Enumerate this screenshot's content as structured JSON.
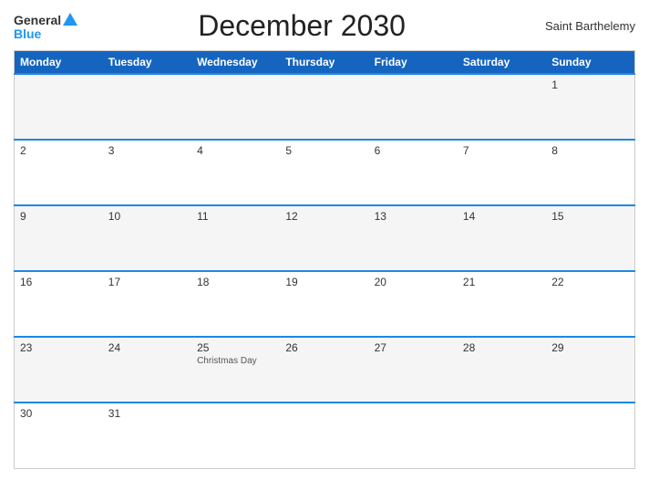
{
  "header": {
    "logo_general": "General",
    "logo_blue": "Blue",
    "title": "December 2030",
    "region": "Saint Barthelemy"
  },
  "weekdays": [
    "Monday",
    "Tuesday",
    "Wednesday",
    "Thursday",
    "Friday",
    "Saturday",
    "Sunday"
  ],
  "weeks": [
    [
      {
        "num": "",
        "holiday": ""
      },
      {
        "num": "",
        "holiday": ""
      },
      {
        "num": "",
        "holiday": ""
      },
      {
        "num": "",
        "holiday": ""
      },
      {
        "num": "",
        "holiday": ""
      },
      {
        "num": "",
        "holiday": ""
      },
      {
        "num": "1",
        "holiday": ""
      }
    ],
    [
      {
        "num": "2",
        "holiday": ""
      },
      {
        "num": "3",
        "holiday": ""
      },
      {
        "num": "4",
        "holiday": ""
      },
      {
        "num": "5",
        "holiday": ""
      },
      {
        "num": "6",
        "holiday": ""
      },
      {
        "num": "7",
        "holiday": ""
      },
      {
        "num": "8",
        "holiday": ""
      }
    ],
    [
      {
        "num": "9",
        "holiday": ""
      },
      {
        "num": "10",
        "holiday": ""
      },
      {
        "num": "11",
        "holiday": ""
      },
      {
        "num": "12",
        "holiday": ""
      },
      {
        "num": "13",
        "holiday": ""
      },
      {
        "num": "14",
        "holiday": ""
      },
      {
        "num": "15",
        "holiday": ""
      }
    ],
    [
      {
        "num": "16",
        "holiday": ""
      },
      {
        "num": "17",
        "holiday": ""
      },
      {
        "num": "18",
        "holiday": ""
      },
      {
        "num": "19",
        "holiday": ""
      },
      {
        "num": "20",
        "holiday": ""
      },
      {
        "num": "21",
        "holiday": ""
      },
      {
        "num": "22",
        "holiday": ""
      }
    ],
    [
      {
        "num": "23",
        "holiday": ""
      },
      {
        "num": "24",
        "holiday": ""
      },
      {
        "num": "25",
        "holiday": "Christmas Day"
      },
      {
        "num": "26",
        "holiday": ""
      },
      {
        "num": "27",
        "holiday": ""
      },
      {
        "num": "28",
        "holiday": ""
      },
      {
        "num": "29",
        "holiday": ""
      }
    ],
    [
      {
        "num": "30",
        "holiday": ""
      },
      {
        "num": "31",
        "holiday": ""
      },
      {
        "num": "",
        "holiday": ""
      },
      {
        "num": "",
        "holiday": ""
      },
      {
        "num": "",
        "holiday": ""
      },
      {
        "num": "",
        "holiday": ""
      },
      {
        "num": "",
        "holiday": ""
      }
    ]
  ]
}
